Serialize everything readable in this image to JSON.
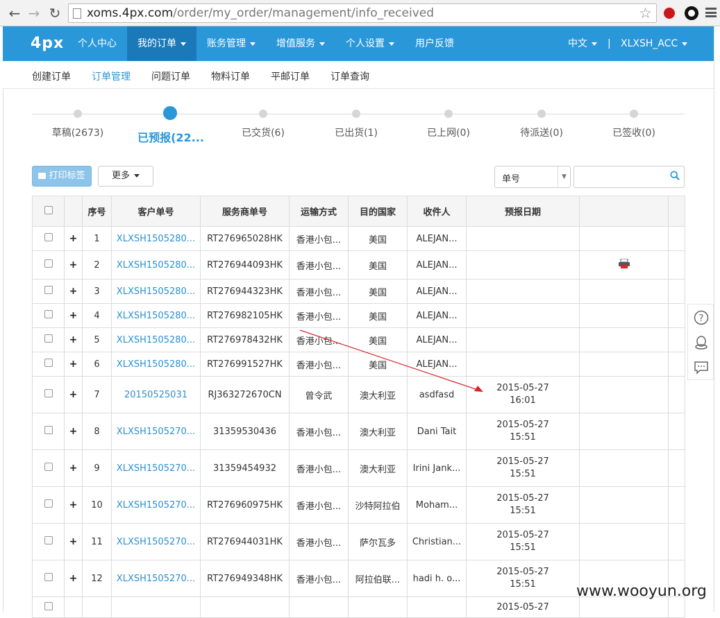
{
  "browser": {
    "url_host": "xoms.4px.com",
    "url_path": "/order/my_order/management/info_received"
  },
  "topnav": {
    "logo": "4px",
    "items": [
      "个人中心",
      "我的订单",
      "账务管理",
      "增值服务",
      "个人设置",
      "用户反馈"
    ],
    "lang": "中文",
    "separator": "|",
    "user": "XLXSH_ACC"
  },
  "subnav": {
    "items": [
      "创建订单",
      "订单管理",
      "问题订单",
      "物料订单",
      "平邮订单",
      "订单查询"
    ]
  },
  "steps": [
    "草稿(2673)",
    "已预报(22...",
    "已交货(6)",
    "已出货(1)",
    "已上网(0)",
    "待派送(0)",
    "已签收(0)"
  ],
  "toolbar": {
    "print_label": "打印标签",
    "more_label": "更多",
    "select_value": "单号"
  },
  "table": {
    "headers": [
      "序号",
      "客户单号",
      "服务商单号",
      "运输方式",
      "目的国家",
      "收件人",
      "预报日期"
    ],
    "rows": [
      {
        "no": "1",
        "customer": "XLXSH1505280...",
        "service": "RT276965028HK",
        "ship": "香港小包...",
        "country": "美国",
        "recipient": "ALEJAN...",
        "date": "",
        "time": ""
      },
      {
        "no": "2",
        "customer": "XLXSH1505280...",
        "service": "RT276944093HK",
        "ship": "香港小包...",
        "country": "美国",
        "recipient": "ALEJAN...",
        "date": "",
        "time": ""
      },
      {
        "no": "3",
        "customer": "XLXSH1505280...",
        "service": "RT276944323HK",
        "ship": "香港小包...",
        "country": "美国",
        "recipient": "ALEJAN...",
        "date": "",
        "time": ""
      },
      {
        "no": "4",
        "customer": "XLXSH1505280...",
        "service": "RT276982105HK",
        "ship": "香港小包...",
        "country": "美国",
        "recipient": "ALEJAN...",
        "date": "",
        "time": ""
      },
      {
        "no": "5",
        "customer": "XLXSH1505280...",
        "service": "RT276978432HK",
        "ship": "香港小包...",
        "country": "美国",
        "recipient": "ALEJAN...",
        "date": "",
        "time": ""
      },
      {
        "no": "6",
        "customer": "XLXSH1505280...",
        "service": "RT276991527HK",
        "ship": "香港小包...",
        "country": "美国",
        "recipient": "ALEJAN...",
        "date": "",
        "time": ""
      },
      {
        "no": "7",
        "customer": "20150525031",
        "service": "RJ363272670CN",
        "ship": "曾令武",
        "country": "澳大利亚",
        "recipient": "asdfasd",
        "date": "2015-05-27",
        "time": "16:01"
      },
      {
        "no": "8",
        "customer": "XLXSH1505270...",
        "service": "31359530436",
        "ship": "香港小包...",
        "country": "澳大利亚",
        "recipient": "Dani Tait",
        "date": "2015-05-27",
        "time": "15:51"
      },
      {
        "no": "9",
        "customer": "XLXSH1505270...",
        "service": "31359454932",
        "ship": "香港小包...",
        "country": "澳大利亚",
        "recipient": "Irini Jank...",
        "date": "2015-05-27",
        "time": "15:51"
      },
      {
        "no": "10",
        "customer": "XLXSH1505270...",
        "service": "RT276960975HK",
        "ship": "香港小包...",
        "country": "沙特阿拉伯",
        "recipient": "Moham...",
        "date": "2015-05-27",
        "time": "15:51"
      },
      {
        "no": "11",
        "customer": "XLXSH1505270...",
        "service": "RT276944031HK",
        "ship": "香港小包...",
        "country": "萨尔瓦多",
        "recipient": "Christian...",
        "date": "2015-05-27",
        "time": "15:51"
      },
      {
        "no": "12",
        "customer": "XLXSH1505270...",
        "service": "RT276949348HK",
        "ship": "香港小包...",
        "country": "阿拉伯联...",
        "recipient": "hadi h. o...",
        "date": "2015-05-27",
        "time": "15:51"
      },
      {
        "no": "",
        "customer": "",
        "service": "",
        "ship": "",
        "country": "",
        "recipient": "",
        "date": "2015-05-27",
        "time": ""
      }
    ]
  },
  "watermark": "www.wooyun.org",
  "colors": {
    "primary": "#2a97d8",
    "primary_dark": "#1c79b8",
    "link": "#2a8fd0",
    "annotation": "#d9262b"
  }
}
